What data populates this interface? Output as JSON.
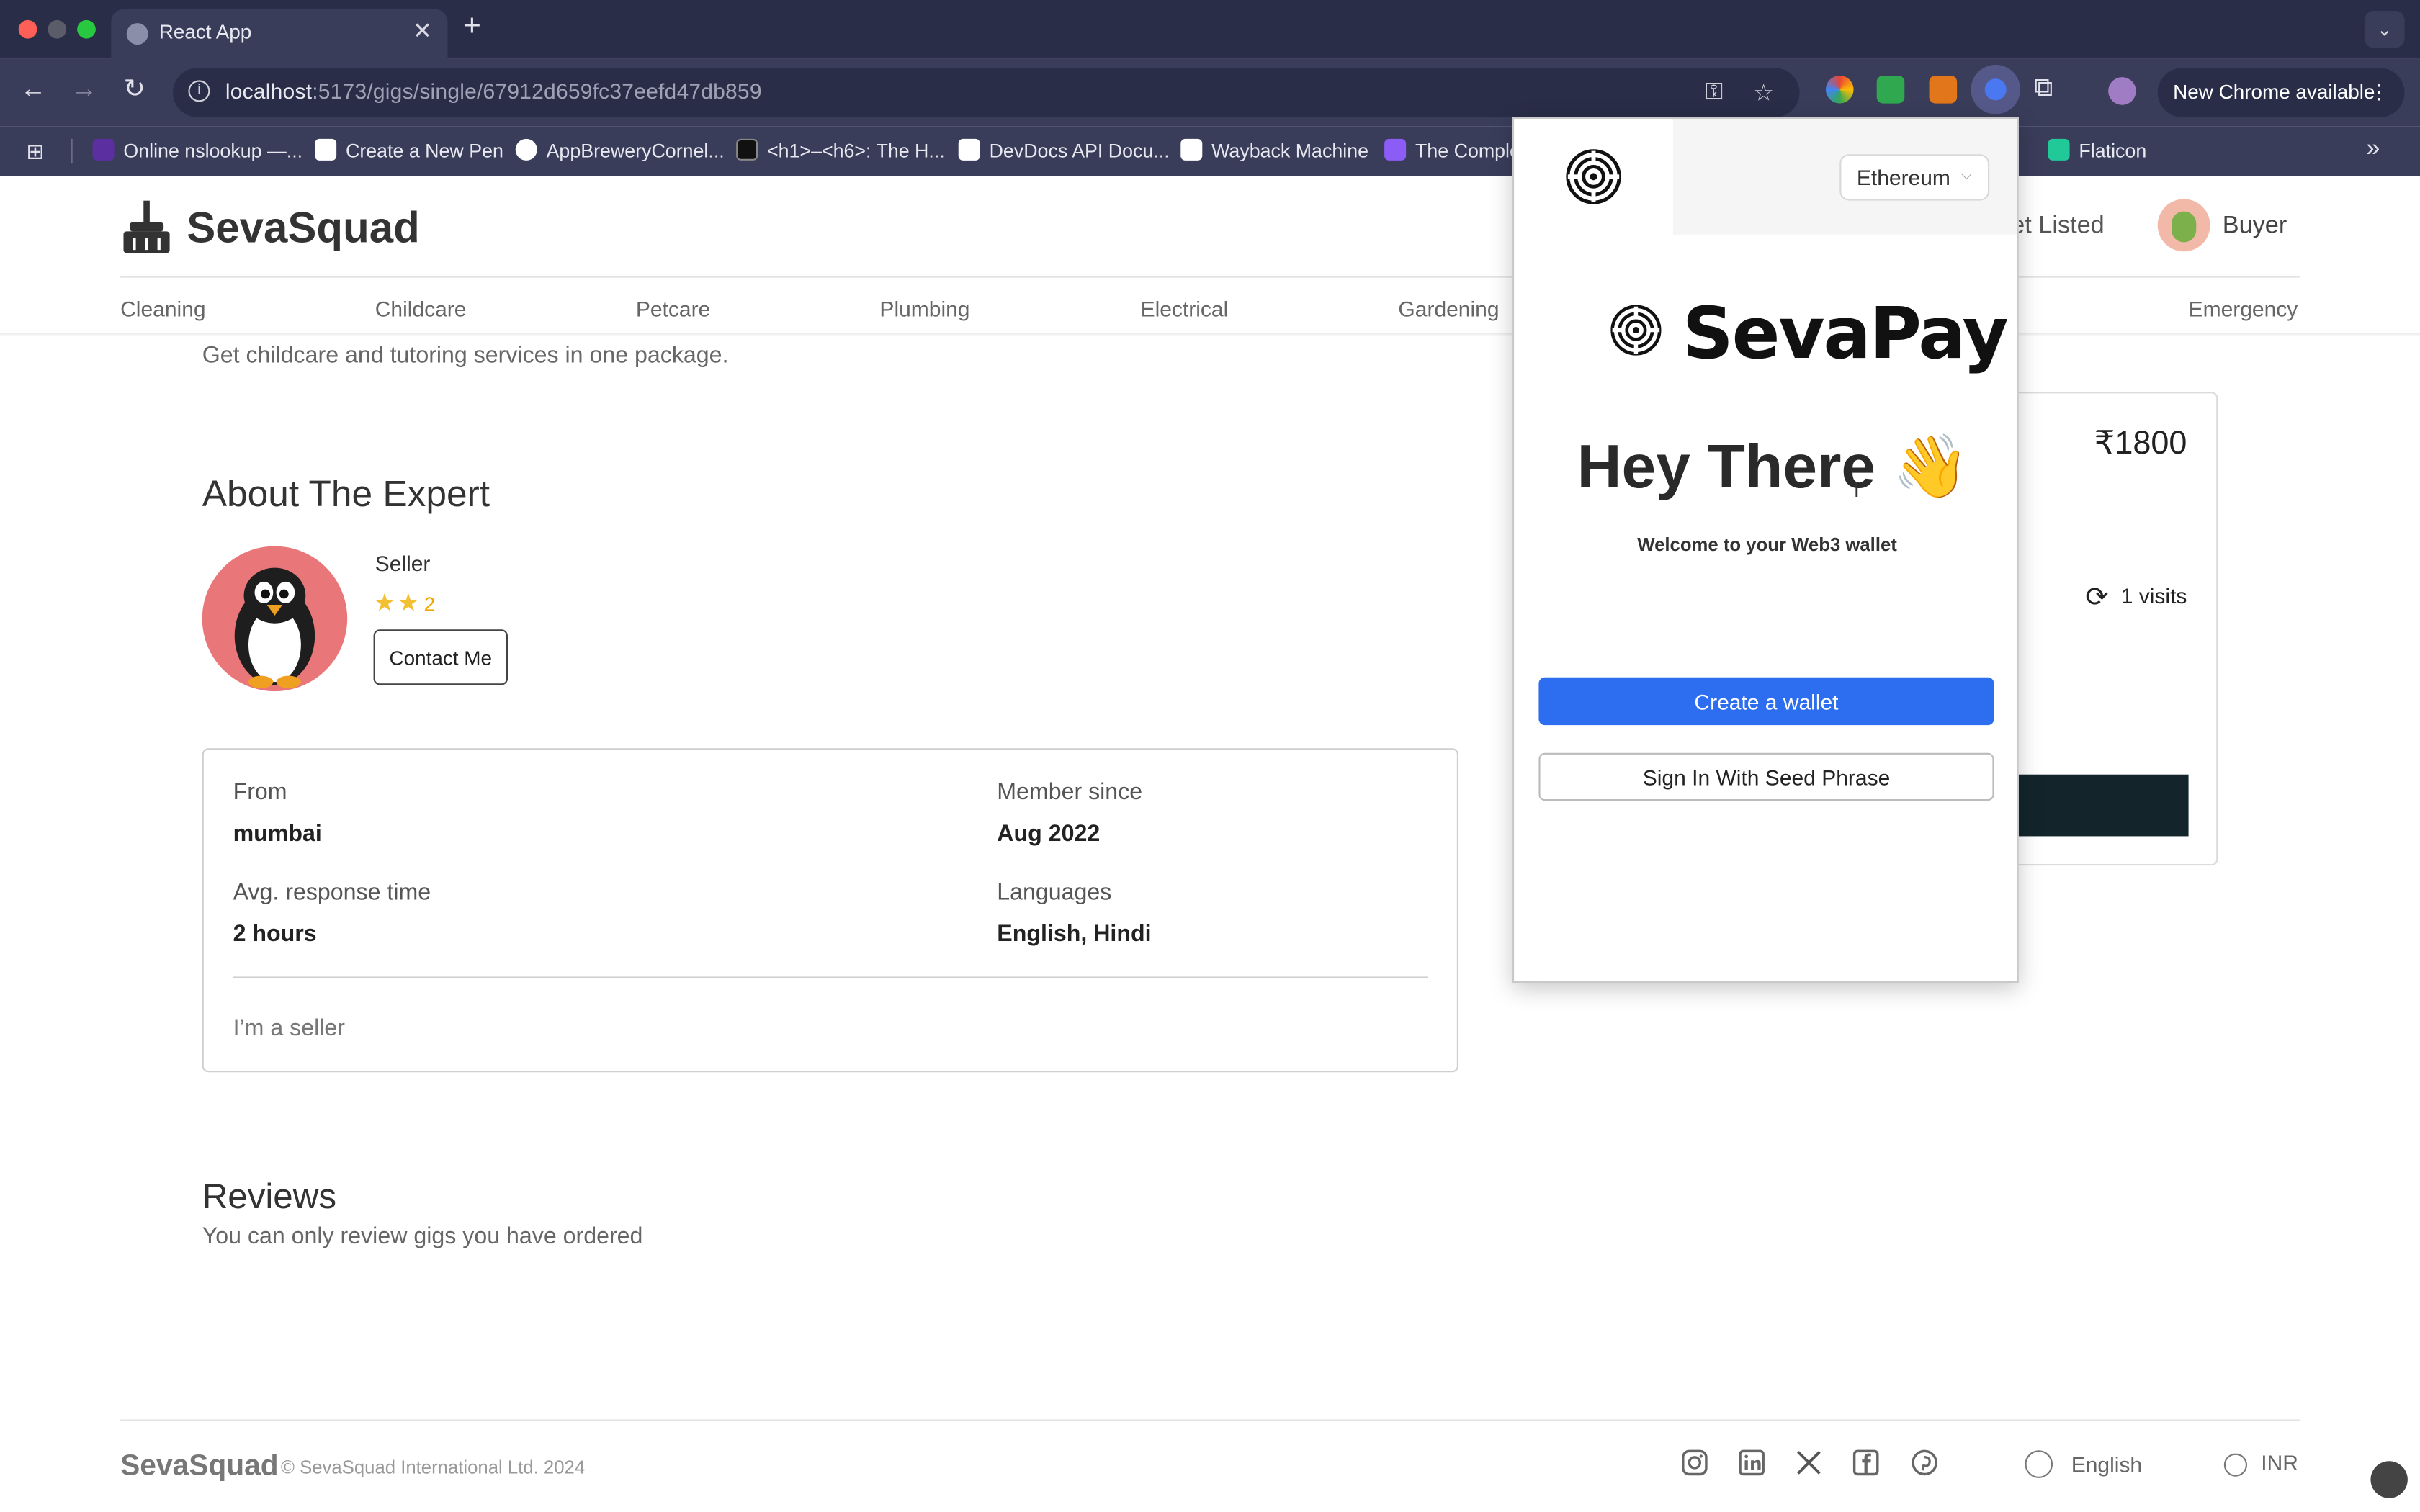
{
  "browser": {
    "tab_title": "React App",
    "url_host": "localhost",
    "url_rest": ":5173/gigs/single/67912d659fc37eefd47db859",
    "new_chrome": "New Chrome available",
    "bookmarks": [
      {
        "label": "Online nslookup —...",
        "color": "#5b2fa0"
      },
      {
        "label": "Create a New Pen",
        "color": "#ffffff"
      },
      {
        "label": "AppBreweryCornel...",
        "color": "#ffffff"
      },
      {
        "label": "<h1>–<h6>: The H...",
        "color": "#111111"
      },
      {
        "label": "DevDocs API Docu...",
        "color": "#ffffff"
      },
      {
        "label": "Wayback Machine",
        "color": "#ffffff"
      },
      {
        "label": "The Comple",
        "color": "#8b5cf6"
      },
      {
        "label": "Flaticon",
        "color": "#20c997"
      }
    ]
  },
  "header": {
    "logo": "SevaSquad",
    "get_listed": "et Listed",
    "user": "Buyer",
    "categories": [
      "Cleaning",
      "Childcare",
      "Petcare",
      "Plumbing",
      "Electrical",
      "Gardening",
      "Emergency"
    ]
  },
  "gig": {
    "intro": "Get childcare and tutoring services in one package.",
    "about_heading": "About The Expert",
    "seller_name": "Seller",
    "stars": "★★",
    "rating": "2",
    "contact_label": "Contact Me",
    "info": {
      "from_label": "From",
      "from_value": "mumbai",
      "member_label": "Member since",
      "member_value": "Aug 2022",
      "response_label": "Avg. response time",
      "response_value": "2 hours",
      "lang_label": "Languages",
      "lang_value": "English, Hindi",
      "description": "I’m a seller"
    },
    "reviews_heading": "Reviews",
    "reviews_note": "You can only review gigs you have ordered",
    "price": "₹1800",
    "visits": "1 visits"
  },
  "footer": {
    "logo": "SevaSquad",
    "copyright": "© SevaSquad International Ltd. 2024",
    "language": "English",
    "currency": "INR",
    "socials": [
      "instagram-icon",
      "linkedin-icon",
      "x-icon",
      "facebook-icon",
      "pinterest-icon"
    ]
  },
  "wallet": {
    "network": "Ethereum",
    "brand": "SevaPay",
    "greeting": "Hey There 👋",
    "welcome": "Welcome to your Web3 wallet",
    "create_label": "Create a wallet",
    "seed_label": "Sign In With Seed Phrase",
    "accent": "#2d6ef0"
  }
}
